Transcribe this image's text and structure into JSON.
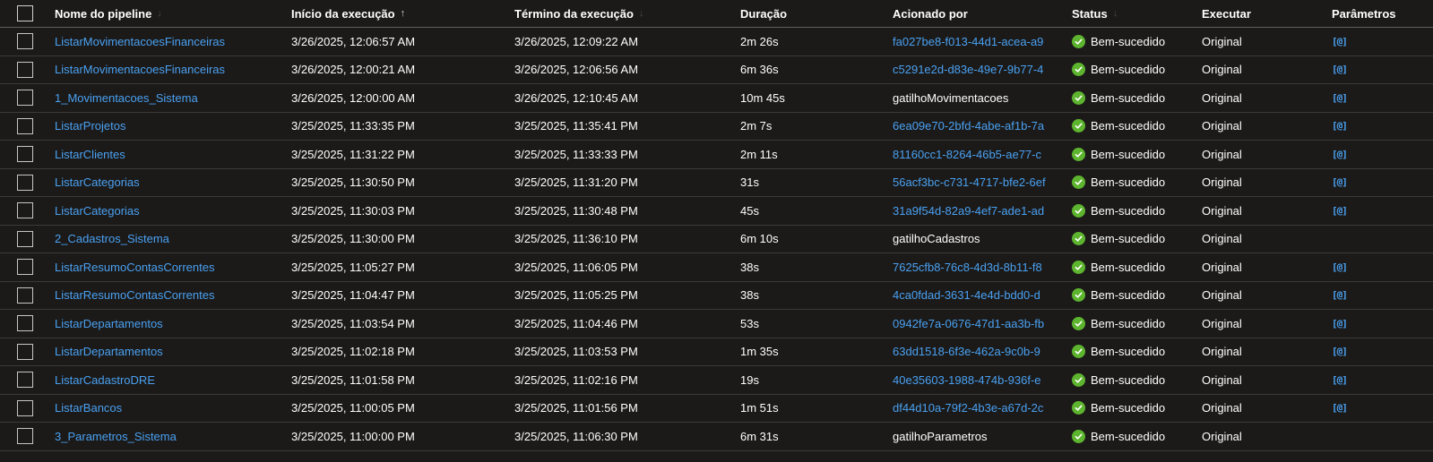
{
  "header": {
    "pipeline_name": "Nome do pipeline",
    "run_start": "Início da execução",
    "run_end": "Término da execução",
    "duration": "Duração",
    "triggered_by": "Acionado por",
    "status": "Status",
    "run": "Executar",
    "parameters": "Parâmetros",
    "sort_active_glyph": "↑",
    "sort_inactive_glyph": "↓"
  },
  "colors": {
    "background": "#1b1a19",
    "link": "#4aa0f0",
    "success": "#5db42e",
    "text": "#ffffff"
  },
  "icons": {
    "status": "check-circle-icon",
    "parameters": "parameters-icon",
    "parameters_glyph": "[@]"
  },
  "rows": [
    {
      "name": "ListarMovimentacoesFinanceiras",
      "start": "3/26/2025, 12:06:57 AM",
      "end": "3/26/2025, 12:09:22 AM",
      "duration": "2m 26s",
      "triggered_by": "fa027be8-f013-44d1-acea-a9",
      "trigger_is_link": true,
      "status": "Bem-sucedido",
      "run": "Original",
      "has_params": true
    },
    {
      "name": "ListarMovimentacoesFinanceiras",
      "start": "3/26/2025, 12:00:21 AM",
      "end": "3/26/2025, 12:06:56 AM",
      "duration": "6m 36s",
      "triggered_by": "c5291e2d-d83e-49e7-9b77-4",
      "trigger_is_link": true,
      "status": "Bem-sucedido",
      "run": "Original",
      "has_params": true
    },
    {
      "name": "1_Movimentacoes_Sistema",
      "start": "3/26/2025, 12:00:00 AM",
      "end": "3/26/2025, 12:10:45 AM",
      "duration": "10m 45s",
      "triggered_by": "gatilhoMovimentacoes",
      "trigger_is_link": false,
      "status": "Bem-sucedido",
      "run": "Original",
      "has_params": true
    },
    {
      "name": "ListarProjetos",
      "start": "3/25/2025, 11:33:35 PM",
      "end": "3/25/2025, 11:35:41 PM",
      "duration": "2m 7s",
      "triggered_by": "6ea09e70-2bfd-4abe-af1b-7a",
      "trigger_is_link": true,
      "status": "Bem-sucedido",
      "run": "Original",
      "has_params": true
    },
    {
      "name": "ListarClientes",
      "start": "3/25/2025, 11:31:22 PM",
      "end": "3/25/2025, 11:33:33 PM",
      "duration": "2m 11s",
      "triggered_by": "81160cc1-8264-46b5-ae77-c",
      "trigger_is_link": true,
      "status": "Bem-sucedido",
      "run": "Original",
      "has_params": true
    },
    {
      "name": "ListarCategorias",
      "start": "3/25/2025, 11:30:50 PM",
      "end": "3/25/2025, 11:31:20 PM",
      "duration": "31s",
      "triggered_by": "56acf3bc-c731-4717-bfe2-6ef",
      "trigger_is_link": true,
      "status": "Bem-sucedido",
      "run": "Original",
      "has_params": true
    },
    {
      "name": "ListarCategorias",
      "start": "3/25/2025, 11:30:03 PM",
      "end": "3/25/2025, 11:30:48 PM",
      "duration": "45s",
      "triggered_by": "31a9f54d-82a9-4ef7-ade1-ad",
      "trigger_is_link": true,
      "status": "Bem-sucedido",
      "run": "Original",
      "has_params": true
    },
    {
      "name": "2_Cadastros_Sistema",
      "start": "3/25/2025, 11:30:00 PM",
      "end": "3/25/2025, 11:36:10 PM",
      "duration": "6m 10s",
      "triggered_by": "gatilhoCadastros",
      "trigger_is_link": false,
      "status": "Bem-sucedido",
      "run": "Original",
      "has_params": false
    },
    {
      "name": "ListarResumoContasCorrentes",
      "start": "3/25/2025, 11:05:27 PM",
      "end": "3/25/2025, 11:06:05 PM",
      "duration": "38s",
      "triggered_by": "7625cfb8-76c8-4d3d-8b11-f8",
      "trigger_is_link": true,
      "status": "Bem-sucedido",
      "run": "Original",
      "has_params": true
    },
    {
      "name": "ListarResumoContasCorrentes",
      "start": "3/25/2025, 11:04:47 PM",
      "end": "3/25/2025, 11:05:25 PM",
      "duration": "38s",
      "triggered_by": "4ca0fdad-3631-4e4d-bdd0-d",
      "trigger_is_link": true,
      "status": "Bem-sucedido",
      "run": "Original",
      "has_params": true
    },
    {
      "name": "ListarDepartamentos",
      "start": "3/25/2025, 11:03:54 PM",
      "end": "3/25/2025, 11:04:46 PM",
      "duration": "53s",
      "triggered_by": "0942fe7a-0676-47d1-aa3b-fb",
      "trigger_is_link": true,
      "status": "Bem-sucedido",
      "run": "Original",
      "has_params": true
    },
    {
      "name": "ListarDepartamentos",
      "start": "3/25/2025, 11:02:18 PM",
      "end": "3/25/2025, 11:03:53 PM",
      "duration": "1m 35s",
      "triggered_by": "63dd1518-6f3e-462a-9c0b-9",
      "trigger_is_link": true,
      "status": "Bem-sucedido",
      "run": "Original",
      "has_params": true
    },
    {
      "name": "ListarCadastroDRE",
      "start": "3/25/2025, 11:01:58 PM",
      "end": "3/25/2025, 11:02:16 PM",
      "duration": "19s",
      "triggered_by": "40e35603-1988-474b-936f-e",
      "trigger_is_link": true,
      "status": "Bem-sucedido",
      "run": "Original",
      "has_params": true
    },
    {
      "name": "ListarBancos",
      "start": "3/25/2025, 11:00:05 PM",
      "end": "3/25/2025, 11:01:56 PM",
      "duration": "1m 51s",
      "triggered_by": "df44d10a-79f2-4b3e-a67d-2c",
      "trigger_is_link": true,
      "status": "Bem-sucedido",
      "run": "Original",
      "has_params": true
    },
    {
      "name": "3_Parametros_Sistema",
      "start": "3/25/2025, 11:00:00 PM",
      "end": "3/25/2025, 11:06:30 PM",
      "duration": "6m 31s",
      "triggered_by": "gatilhoParametros",
      "trigger_is_link": false,
      "status": "Bem-sucedido",
      "run": "Original",
      "has_params": false
    }
  ]
}
